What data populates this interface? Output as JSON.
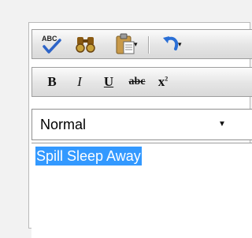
{
  "toolbar1": {
    "spellcheck": "ABC",
    "dropdown_glyph": "▾"
  },
  "toolbar2": {
    "bold": "B",
    "italic": "I",
    "underline": "U",
    "strike": "abc",
    "superscript_base": "x",
    "superscript_exp": "2"
  },
  "format_select": {
    "value": "Normal"
  },
  "editor": {
    "text": "Spill Sleep Away"
  },
  "icons": {
    "spellcheck": "spellcheck-icon",
    "find": "find-binoculars-icon",
    "paste": "paste-icon",
    "undo": "undo-icon"
  },
  "colors": {
    "selection": "#3399ff",
    "undo": "#2a6fd6"
  }
}
